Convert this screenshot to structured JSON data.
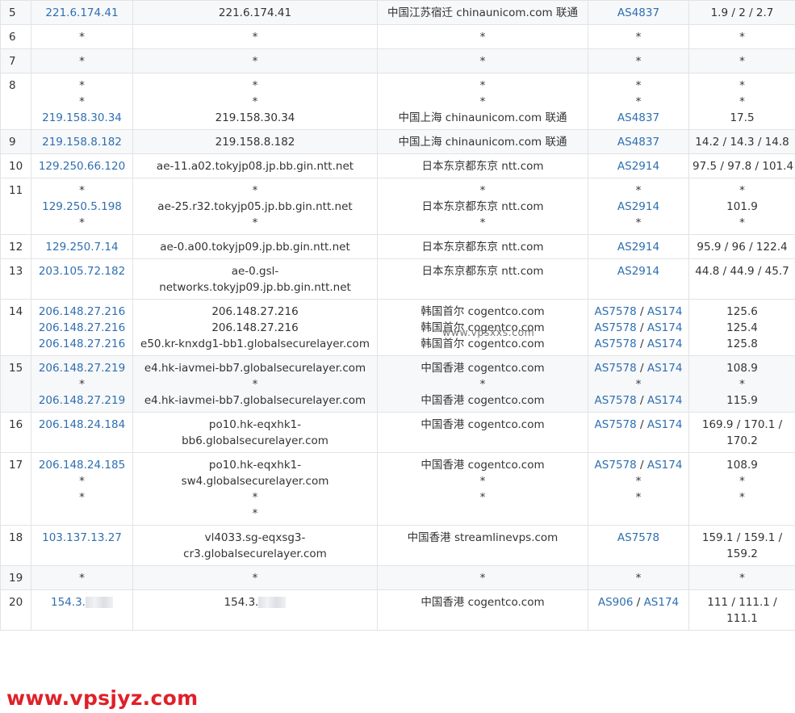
{
  "rows": [
    {
      "hop": "5",
      "alt": true,
      "ip": [
        "221.6.174.41"
      ],
      "host": [
        "221.6.174.41"
      ],
      "loc": [
        "中国江苏宿迁 chinaunicom.com 联通"
      ],
      "as": [
        [
          "AS4837"
        ]
      ],
      "rtt": [
        "1.9 / 2 / 2.7"
      ]
    },
    {
      "hop": "6",
      "alt": false,
      "ip": [
        "*"
      ],
      "host": [
        "*"
      ],
      "loc": [
        "*"
      ],
      "as": [
        [
          "*"
        ]
      ],
      "rtt": [
        "*"
      ]
    },
    {
      "hop": "7",
      "alt": true,
      "ip": [
        "*"
      ],
      "host": [
        "*"
      ],
      "loc": [
        "*"
      ],
      "as": [
        [
          "*"
        ]
      ],
      "rtt": [
        "*"
      ]
    },
    {
      "hop": "8",
      "alt": false,
      "ip": [
        "*",
        "*",
        "219.158.30.34"
      ],
      "host": [
        "*",
        "*",
        "219.158.30.34"
      ],
      "loc": [
        "*",
        "*",
        "中国上海 chinaunicom.com 联通"
      ],
      "as": [
        [
          "*"
        ],
        [
          "*"
        ],
        [
          "AS4837"
        ]
      ],
      "rtt": [
        "*",
        "*",
        "17.5"
      ]
    },
    {
      "hop": "9",
      "alt": true,
      "ip": [
        "219.158.8.182"
      ],
      "host": [
        "219.158.8.182"
      ],
      "loc": [
        "中国上海 chinaunicom.com 联通"
      ],
      "as": [
        [
          "AS4837"
        ]
      ],
      "rtt": [
        "14.2 / 14.3 / 14.8"
      ]
    },
    {
      "hop": "10",
      "alt": false,
      "ip": [
        "129.250.66.120"
      ],
      "host": [
        "ae-11.a02.tokyjp08.jp.bb.gin.ntt.net"
      ],
      "loc": [
        "日本东京都东京 ntt.com"
      ],
      "as": [
        [
          "AS2914"
        ]
      ],
      "rtt": [
        "97.5 / 97.8 / 101.4"
      ]
    },
    {
      "hop": "11",
      "alt": false,
      "ip": [
        "*",
        "129.250.5.198",
        "*"
      ],
      "host": [
        "*",
        "ae-25.r32.tokyjp05.jp.bb.gin.ntt.net",
        "*"
      ],
      "loc": [
        "*",
        "日本东京都东京 ntt.com",
        "*"
      ],
      "as": [
        [
          "*"
        ],
        [
          "AS2914"
        ],
        [
          "*"
        ]
      ],
      "rtt": [
        "*",
        "101.9",
        "*"
      ]
    },
    {
      "hop": "12",
      "alt": false,
      "ip": [
        "129.250.7.14"
      ],
      "host": [
        "ae-0.a00.tokyjp09.jp.bb.gin.ntt.net"
      ],
      "loc": [
        "日本东京都东京 ntt.com"
      ],
      "as": [
        [
          "AS2914"
        ]
      ],
      "rtt": [
        "95.9 / 96 / 122.4"
      ]
    },
    {
      "hop": "13",
      "alt": false,
      "ip": [
        "203.105.72.182"
      ],
      "host": [
        "ae-0.gsl-",
        "networks.tokyjp09.jp.bb.gin.ntt.net"
      ],
      "loc": [
        "日本东京都东京 ntt.com"
      ],
      "as": [
        [
          "AS2914"
        ]
      ],
      "rtt": [
        "44.8 / 44.9 / 45.7"
      ]
    },
    {
      "hop": "14",
      "alt": false,
      "ip": [
        "206.148.27.216",
        "206.148.27.216",
        "206.148.27.216"
      ],
      "host": [
        "206.148.27.216",
        "206.148.27.216",
        "e50.kr-knxdg1-bb1.globalsecurelayer.com"
      ],
      "loc": [
        "韩国首尔 cogentco.com",
        "韩国首尔 cogentco.com",
        "韩国首尔 cogentco.com"
      ],
      "as": [
        [
          "AS7578",
          "AS174"
        ],
        [
          "AS7578",
          "AS174"
        ],
        [
          "AS7578",
          "AS174"
        ]
      ],
      "rtt": [
        "125.6",
        "125.4",
        "125.8"
      ]
    },
    {
      "hop": "15",
      "alt": true,
      "ip": [
        "206.148.27.219",
        "*",
        "206.148.27.219"
      ],
      "host": [
        "e4.hk-iavmei-bb7.globalsecurelayer.com",
        "*",
        "e4.hk-iavmei-bb7.globalsecurelayer.com"
      ],
      "loc": [
        "中国香港 cogentco.com",
        "*",
        "中国香港 cogentco.com"
      ],
      "as": [
        [
          "AS7578",
          "AS174"
        ],
        [
          "*"
        ],
        [
          "AS7578",
          "AS174"
        ]
      ],
      "rtt": [
        "108.9",
        "*",
        "115.9"
      ]
    },
    {
      "hop": "16",
      "alt": false,
      "ip": [
        "206.148.24.184"
      ],
      "host": [
        "po10.hk-eqxhk1-",
        "bb6.globalsecurelayer.com"
      ],
      "loc": [
        "中国香港 cogentco.com"
      ],
      "as": [
        [
          "AS7578",
          "AS174"
        ]
      ],
      "rtt": [
        "169.9 / 170.1 /",
        "170.2"
      ]
    },
    {
      "hop": "17",
      "alt": false,
      "ip": [
        "206.148.24.185",
        "*",
        "*"
      ],
      "host": [
        "po10.hk-eqxhk1-",
        "sw4.globalsecurelayer.com",
        "*",
        "*"
      ],
      "loc": [
        "中国香港 cogentco.com",
        "*",
        "*"
      ],
      "as": [
        [
          "AS7578",
          "AS174"
        ],
        [
          "*"
        ],
        [
          "*"
        ]
      ],
      "rtt": [
        "108.9",
        "*",
        "*"
      ]
    },
    {
      "hop": "18",
      "alt": false,
      "ip": [
        "103.137.13.27"
      ],
      "host": [
        "vl4033.sg-eqxsg3-",
        "cr3.globalsecurelayer.com"
      ],
      "loc": [
        "中国香港 streamlinevps.com"
      ],
      "as": [
        [
          "AS7578"
        ]
      ],
      "rtt": [
        "159.1 / 159.1 /",
        "159.2"
      ]
    },
    {
      "hop": "19",
      "alt": true,
      "ip": [
        "*"
      ],
      "host": [
        "*"
      ],
      "loc": [
        "*"
      ],
      "as": [
        [
          "*"
        ]
      ],
      "rtt": [
        "*"
      ]
    },
    {
      "hop": "20",
      "alt": false,
      "ip": [
        "154.3."
      ],
      "host": [
        "154.3."
      ],
      "loc": [
        "中国香港 cogentco.com"
      ],
      "as": [
        [
          "AS906",
          "AS174"
        ]
      ],
      "rtt": [
        "111 / 111.1 /",
        "111.1"
      ]
    }
  ],
  "watermark_small": "www.vpsxxs.com",
  "watermark_big": "www.vpsjyz.com",
  "colors": {
    "link": "#2f6fb0",
    "alt_row": "#f7f8fa",
    "border": "#e3e3e3",
    "watermark": "#e0202a"
  }
}
